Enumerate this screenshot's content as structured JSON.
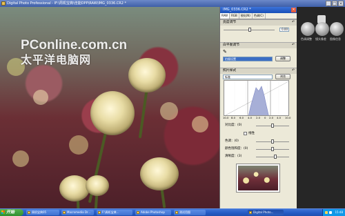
{
  "window": {
    "title": "Digital Photo Professional - IF:\\周机宝典\\佳能DPP\\RAW\\IMG_0336.CR2 *"
  },
  "watermark": {
    "line1": "PConline.com.cn",
    "line2": "太平洋电脑网"
  },
  "panel": {
    "title": "IMG_0336.CR2 *",
    "tabs": [
      "RAW",
      "RGB",
      "锐化(N)",
      "色调(C)"
    ],
    "brightness_label": "亮度调节",
    "brightness_value": "0.00",
    "white_balance_label": "白平衡调节",
    "white_balance_value": "拍摄设置",
    "register_button": "调整",
    "picture_style_label": "照片样式",
    "picture_style_value": "标准",
    "browse_button": "浏览",
    "histogram_scale": [
      "10.0",
      "8.0",
      "6.0",
      "4.0",
      "2.0",
      "0",
      "2.0",
      "4.0",
      "10.0"
    ],
    "contrast_label": "对比度：(0)",
    "linear_label": "线性",
    "color_tone_label": "色调：(0)",
    "saturation_label": "颜色饱和度：(0)",
    "sharpness_label": "清晰度：(3)"
  },
  "right_tools": {
    "tool1": "色调调整",
    "tool2": "镜头像差",
    "tool3": "图像信息"
  },
  "taskbar": {
    "start_label": "开始",
    "items": [
      "周机宝典05",
      "Macromedia Dr...",
      "F:\\周机宝典...",
      "Adobe Photoshop",
      "测试用图",
      "Digital Photo..."
    ],
    "clock": "15:48"
  },
  "colors": {
    "title_blue": "#3f5fa8",
    "panel_bg": "#ece9d8",
    "selected_blue": "#3b6ec4",
    "taskbar_blue": "#245bc5",
    "start_green": "#2f8f2f"
  }
}
